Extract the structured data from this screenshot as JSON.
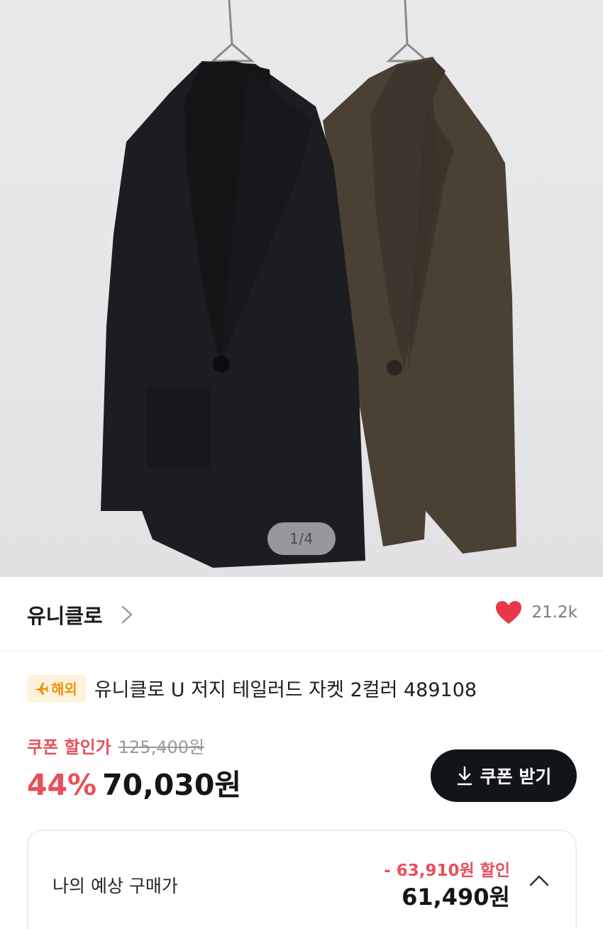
{
  "gallery": {
    "page_indicator": "1/4",
    "colors": {
      "background": "#e6e6e8",
      "jacket_black": "#1c1d20",
      "jacket_brown": "#4a4034"
    }
  },
  "brand": {
    "name": "유니클로",
    "likes": "21.2k",
    "heart_color": "#e8364b"
  },
  "product": {
    "badge": "해외",
    "badge_icon": "airplane-icon",
    "title": "유니클로 U 저지 테일러드 자켓 2컬러 489108"
  },
  "price": {
    "coupon_label": "쿠폰 할인가",
    "original": "125,400원",
    "discount_rate": "44%",
    "sale": "70,030원",
    "accent_color": "#e8505b"
  },
  "coupon_button": {
    "label": "쿠폰 받기",
    "icon": "download-icon"
  },
  "expected": {
    "label": "나의 예상 구매가",
    "discount": "- 63,910원 할인",
    "price": "61,490원",
    "toggle_icon": "chevron-up-icon"
  }
}
